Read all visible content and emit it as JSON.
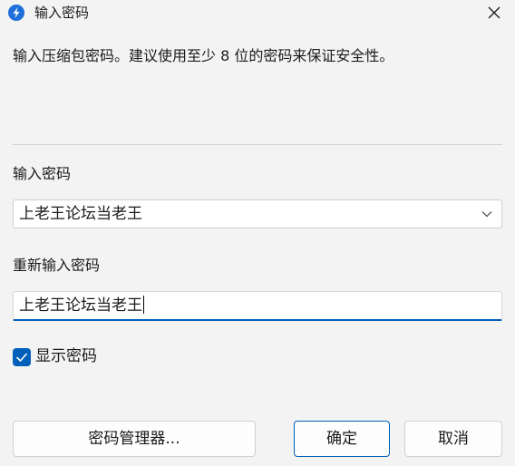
{
  "window": {
    "title": "输入密码",
    "close_icon": "close-icon",
    "app_icon": "app-lightning-icon"
  },
  "description": "输入压缩包密码。建议使用至少 8 位的密码来保证安全性。",
  "password": {
    "label": "输入密码",
    "value": "上老王论坛当老王"
  },
  "confirm_password": {
    "label": "重新输入密码",
    "value": "上老王论坛当老王"
  },
  "show_password": {
    "label": "显示密码",
    "checked": true
  },
  "buttons": {
    "manager": "密码管理器...",
    "ok": "确定",
    "cancel": "取消"
  },
  "colors": {
    "accent": "#005fb8",
    "background": "#f3f3f3",
    "app_icon": "#1e6fd9"
  }
}
